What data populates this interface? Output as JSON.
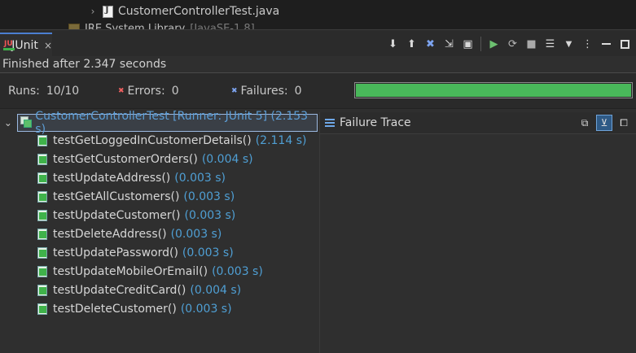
{
  "explorer": {
    "file_name": "CustomerControllerTest.java",
    "library_name": "JRE System Library",
    "library_version": "[JavaSE-1.8]"
  },
  "tab": {
    "label": "JUnit",
    "close": "×"
  },
  "toolbar": {
    "icons": [
      "next-failure-icon",
      "previous-failure-icon",
      "show-failures-only-icon",
      "scroll-lock-icon",
      "show-skipped-icon",
      "rerun-icon",
      "rerun-failed-first-icon",
      "stop-icon",
      "history-icon",
      "view-menu-icon",
      "minimize-icon",
      "maximize-icon"
    ]
  },
  "status": {
    "text": "Finished after 2.347 seconds"
  },
  "counters": {
    "runs_label": "Runs:",
    "runs_value": "10/10",
    "errors_label": "Errors:",
    "errors_value": "0",
    "failures_label": "Failures:",
    "failures_value": "0",
    "progress": 1.0,
    "progress_color": "#49b85a"
  },
  "tree": {
    "root": {
      "name": "CustomerControllerTest [Runner: JUnit 5] (2.153 s)"
    },
    "tests": [
      {
        "name": "testGetLoggedInCustomerDetails()",
        "time": "(2.114 s)"
      },
      {
        "name": "testGetCustomerOrders()",
        "time": "(0.004 s)"
      },
      {
        "name": "testUpdateAddress()",
        "time": "(0.003 s)"
      },
      {
        "name": "testGetAllCustomers()",
        "time": "(0.003 s)"
      },
      {
        "name": "testUpdateCustomer()",
        "time": "(0.003 s)"
      },
      {
        "name": "testDeleteAddress()",
        "time": "(0.003 s)"
      },
      {
        "name": "testUpdatePassword()",
        "time": "(0.003 s)"
      },
      {
        "name": "testUpdateMobileOrEmail()",
        "time": "(0.003 s)"
      },
      {
        "name": "testUpdateCreditCard()",
        "time": "(0.004 s)"
      },
      {
        "name": "testDeleteCustomer()",
        "time": "(0.003 s)"
      }
    ]
  },
  "trace": {
    "title": "Failure Trace"
  },
  "colors": {
    "accent": "#4b7fd1",
    "pass": "#3fb24a",
    "time": "#4f9fd4",
    "root_text": "#5d9fd8"
  }
}
